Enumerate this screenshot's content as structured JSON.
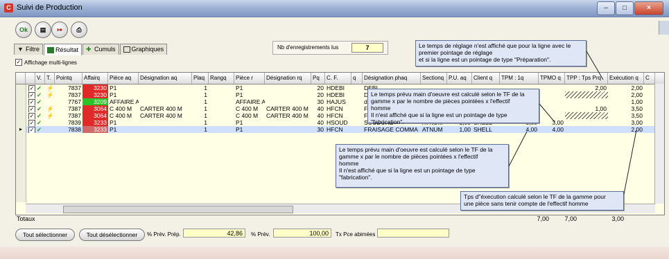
{
  "window": {
    "title": "Suivi de Production",
    "app_icon": "C"
  },
  "toolbar": {
    "buttons": [
      "Ok",
      "filter",
      "exit",
      "print"
    ]
  },
  "tabs": [
    {
      "label": "Filtre",
      "icon": "funnel-icon"
    },
    {
      "label": "Résultat",
      "icon": "table-icon"
    },
    {
      "label": "Cumuls",
      "icon": "sum-icon"
    },
    {
      "label": "Graphiques",
      "icon": "chart-icon"
    }
  ],
  "records": {
    "label": "Nb d'enregistrements lus",
    "value": "7"
  },
  "multiline": {
    "label": "Affichage multi-lignes",
    "checked": true
  },
  "grid": {
    "columns": [
      "V.",
      "T.",
      "Pointq",
      "Affairq",
      "Pièce aq",
      "Désignation aq",
      "Plaq",
      "Rangq",
      "Pièce r",
      "Désignation rq",
      "Pq",
      "C. F.",
      "q",
      "Désignation phaq",
      "Sectionq",
      "P.U. aq",
      "Client q",
      "TPM : 1q",
      "TPMO q",
      "TPP : Tps Prq",
      "Exécution q",
      "C"
    ],
    "rows": [
      {
        "v": "✓",
        "t": "⚡",
        "point": "7837",
        "aff": "3230",
        "aff_color": "#e02a2a",
        "piece": "P1",
        "desig_a": "",
        "pla": "1",
        "piece_r": "P1",
        "desig_r": "",
        "p": "20",
        "cf": "HDEBI",
        "desig_ph": "DEBI",
        "section": "",
        "pu": "",
        "client": "",
        "tpm": "",
        "tpmo": "",
        "tpp": "2,00",
        "exec": "2,00",
        "hatch": false
      },
      {
        "v": "✓",
        "t": "⚡",
        "point": "7837",
        "aff": "3230",
        "aff_color": "#e02a2a",
        "piece": "P1",
        "desig_a": "",
        "pla": "1",
        "piece_r": "P1",
        "desig_r": "",
        "p": "20",
        "cf": "HDEBI",
        "desig_ph": "DEBI",
        "section": "",
        "pu": "",
        "client": "",
        "tpm": "",
        "tpmo": "",
        "tpp": "",
        "exec": "2,00",
        "hatch": true
      },
      {
        "v": "✓",
        "t": "",
        "point": "7767",
        "aff": "3209",
        "aff_color": "#28c428",
        "piece": "AFFAIRE A",
        "desig_a": "",
        "pla": "1",
        "piece_r": "AFFAIRE A'",
        "desig_r": "",
        "p": "30",
        "cf": "HAJUS",
        "desig_ph": "doc",
        "section": "",
        "pu": "",
        "client": "",
        "tpm": "",
        "tpmo": "",
        "tpp": "",
        "exec": "1,00",
        "hatch": false
      },
      {
        "v": "✓",
        "t": "⚡",
        "point": "7387",
        "aff": "3064",
        "aff_color": "#e02a2a",
        "piece": "C 400 M",
        "desig_a": "CARTER 400 M",
        "pla": "1",
        "piece_r": "C 400 M",
        "desig_r": "CARTER 400 M",
        "p": "40",
        "cf": "HFCN",
        "desig_ph": "FRA",
        "section": "",
        "pu": "",
        "client": "",
        "tpm": "",
        "tpmo": "",
        "tpp": "1,00",
        "exec": "3,50",
        "hatch": false
      },
      {
        "v": "✓",
        "t": "⚡",
        "point": "7387",
        "aff": "3064",
        "aff_color": "#e02a2a",
        "piece": "C 400 M",
        "desig_a": "CARTER 400 M",
        "pla": "1",
        "piece_r": "C 400 M",
        "desig_r": "CARTER 400 M",
        "p": "40",
        "cf": "HFCN",
        "desig_ph": "FRA",
        "section": "",
        "pu": "",
        "client": "",
        "tpm": "",
        "tpmo": "",
        "tpp": "",
        "exec": "3,50",
        "hatch": true
      },
      {
        "v": "✓",
        "t": "",
        "point": "7839",
        "aff": "3233",
        "aff_color": "#e02a2a",
        "piece": "P1",
        "desig_a": "",
        "pla": "1",
        "piece_r": "P1",
        "desig_r": "",
        "p": "40",
        "cf": "HSOUD",
        "desig_ph": "SOUDURE",
        "section": "ATNUM",
        "pu": "1,00",
        "client": "SHELL",
        "tpm": "3,00",
        "tpmo": "3,00",
        "tpp": "",
        "exec": "3,00",
        "hatch": false
      },
      {
        "v": "✓",
        "t": "",
        "point": "7838",
        "aff": "3233",
        "aff_color": "#d06a6a",
        "piece": "P1",
        "desig_a": "",
        "pla": "1",
        "piece_r": "P1",
        "desig_r": "",
        "p": "30",
        "cf": "HFCN",
        "desig_ph": "FRAISAGE COMMA",
        "section": "ATNUM",
        "pu": "1,00",
        "client": "SHELL",
        "tpm": "4,00",
        "tpmo": "4,00",
        "tpp": "",
        "exec": "2,00",
        "hatch": false
      }
    ]
  },
  "notes": {
    "reglage": "Le temps de réglage n'est affiché que pour la ligne avec le\npremier pointage de réglage\net si  la ligne est un pointage de type \"Préparation\".",
    "tpm_top": "Le temps prévu main d'oeuvre est calculé  selon le TF de la\ngamme x par le nombre de pièces pointées x  l'effectif\nhomme\nIl n'est affiché que si la ligne est un pointage de type\n\"fabrication\".",
    "tpm_bottom": "Le temps prévu main d'oeuvre est calculé  selon le TF de la\ngamme x par le nombre de pièces pointées x  l'effectif\nhomme\nIl n'est affiché que si la ligne est un pointage de type\n\"fabrication\".",
    "exec": "Tps d''éxecution calculé  selon le TF de la gamme pour\nune pièce sans tenir compte de  l'effectif homme"
  },
  "totals": {
    "label": "Totaux",
    "tpm": "7,00",
    "tpmo": "7,00",
    "tpp": "3,00"
  },
  "bottom": {
    "select_all": "Tout sélectionner",
    "deselect_all": "Tout désélectionner",
    "prev_prep_label": "% Prév. Prép.",
    "prev_prep_value": "42,86",
    "prev_label": "% Prév.",
    "prev_value": "100,00",
    "damaged_label": "Tx Pce abimées",
    "damaged_value": ""
  }
}
